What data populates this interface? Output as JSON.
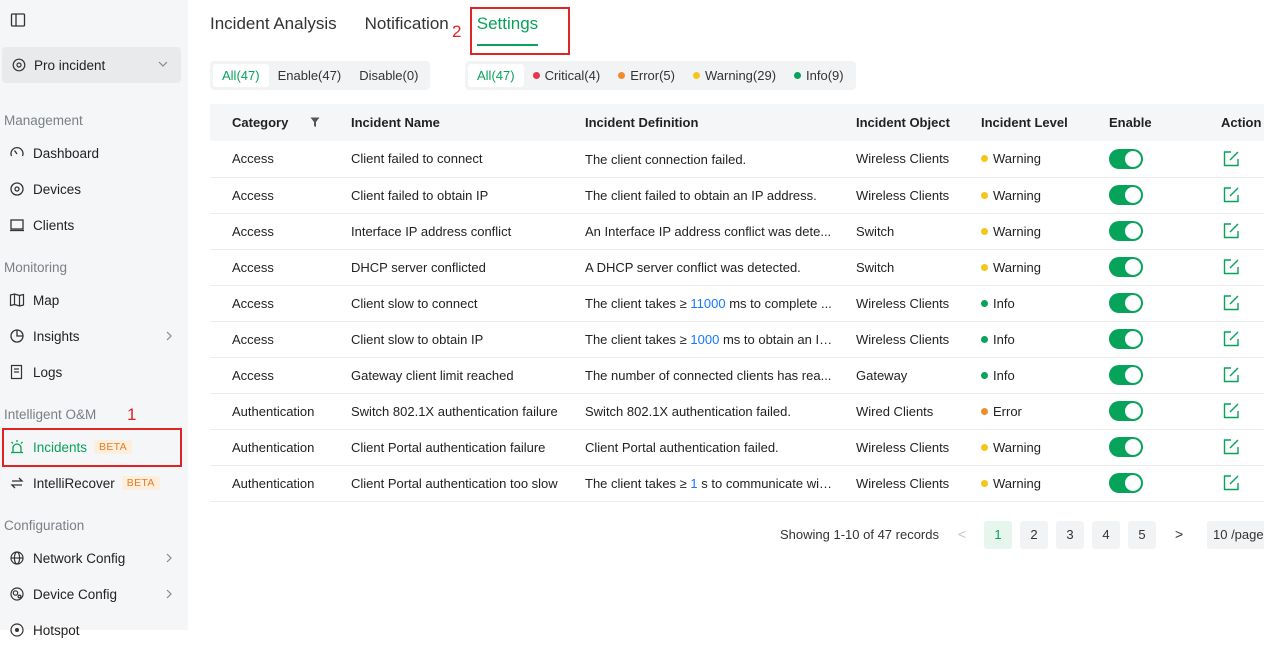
{
  "sidebar": {
    "site": "Pro incident",
    "sections": {
      "management": "Management",
      "monitoring": "Monitoring",
      "intelligent": "Intelligent O&M",
      "configuration": "Configuration"
    },
    "items": {
      "dashboard": "Dashboard",
      "devices": "Devices",
      "clients": "Clients",
      "map": "Map",
      "insights": "Insights",
      "logs": "Logs",
      "incidents": "Incidents",
      "intellirecover": "IntelliRecover",
      "network_config": "Network Config",
      "device_config": "Device Config",
      "hotspot": "Hotspot"
    },
    "beta_label": "BETA"
  },
  "annotations": {
    "label1": "1",
    "label2": "2"
  },
  "tabs": [
    "Incident Analysis",
    "Notification",
    "Settings"
  ],
  "filters": {
    "status": [
      "All(47)",
      "Enable(47)",
      "Disable(0)"
    ],
    "level": [
      "All(47)",
      "Critical(4)",
      "Error(5)",
      "Warning(29)",
      "Info(9)"
    ]
  },
  "colors": {
    "accent": "#07a35a",
    "critical": "#e8344e",
    "error": "#f08c2e",
    "warning": "#f5c518",
    "info": "#07a35a",
    "annotation": "#e02424"
  },
  "table": {
    "headers": [
      "Category",
      "Incident Name",
      "Incident Definition",
      "Incident Object",
      "Incident Level",
      "Enable",
      "Action"
    ],
    "rows": [
      {
        "category": "Access",
        "name": "Client failed to connect",
        "def_pre": "The client connection failed.",
        "def_num": "",
        "def_post": "",
        "object": "Wireless Clients",
        "level": "Warning"
      },
      {
        "category": "Access",
        "name": "Client failed to obtain IP",
        "def_pre": "The client failed to obtain an IP address.",
        "def_num": "",
        "def_post": "",
        "object": "Wireless Clients",
        "level": "Warning"
      },
      {
        "category": "Access",
        "name": "Interface IP address conflict",
        "def_pre": "An Interface IP address conflict was dete...",
        "def_num": "",
        "def_post": "",
        "object": "Switch",
        "level": "Warning"
      },
      {
        "category": "Access",
        "name": "DHCP server conflicted",
        "def_pre": "A DHCP server conflict was detected.",
        "def_num": "",
        "def_post": "",
        "object": "Switch",
        "level": "Warning"
      },
      {
        "category": "Access",
        "name": "Client slow to connect",
        "def_pre": "The client takes ≥ ",
        "def_num": "11000",
        "def_post": " ms to complete ...",
        "object": "Wireless Clients",
        "level": "Info"
      },
      {
        "category": "Access",
        "name": "Client slow to obtain IP",
        "def_pre": "The client takes ≥ ",
        "def_num": "1000",
        "def_post": " ms to obtain an IP...",
        "object": "Wireless Clients",
        "level": "Info"
      },
      {
        "category": "Access",
        "name": "Gateway client limit reached",
        "def_pre": "The number of connected clients has rea...",
        "def_num": "",
        "def_post": "",
        "object": "Gateway",
        "level": "Info"
      },
      {
        "category": "Authentication",
        "name": "Switch 802.1X authentication failure",
        "def_pre": "Switch 802.1X authentication failed.",
        "def_num": "",
        "def_post": "",
        "object": "Wired Clients",
        "level": "Error"
      },
      {
        "category": "Authentication",
        "name": "Client Portal authentication failure",
        "def_pre": "Client Portal authentication failed.",
        "def_num": "",
        "def_post": "",
        "object": "Wireless Clients",
        "level": "Warning"
      },
      {
        "category": "Authentication",
        "name": "Client Portal authentication too slow",
        "def_pre": "The client takes ≥ ",
        "def_num": "1",
        "def_post": " s to communicate wit...",
        "object": "Wireless Clients",
        "level": "Warning"
      }
    ]
  },
  "pagination": {
    "info": "Showing 1-10 of 47 records",
    "pages": [
      "1",
      "2",
      "3",
      "4",
      "5"
    ],
    "prev": "<",
    "next": ">",
    "per_page": "10 /page"
  }
}
